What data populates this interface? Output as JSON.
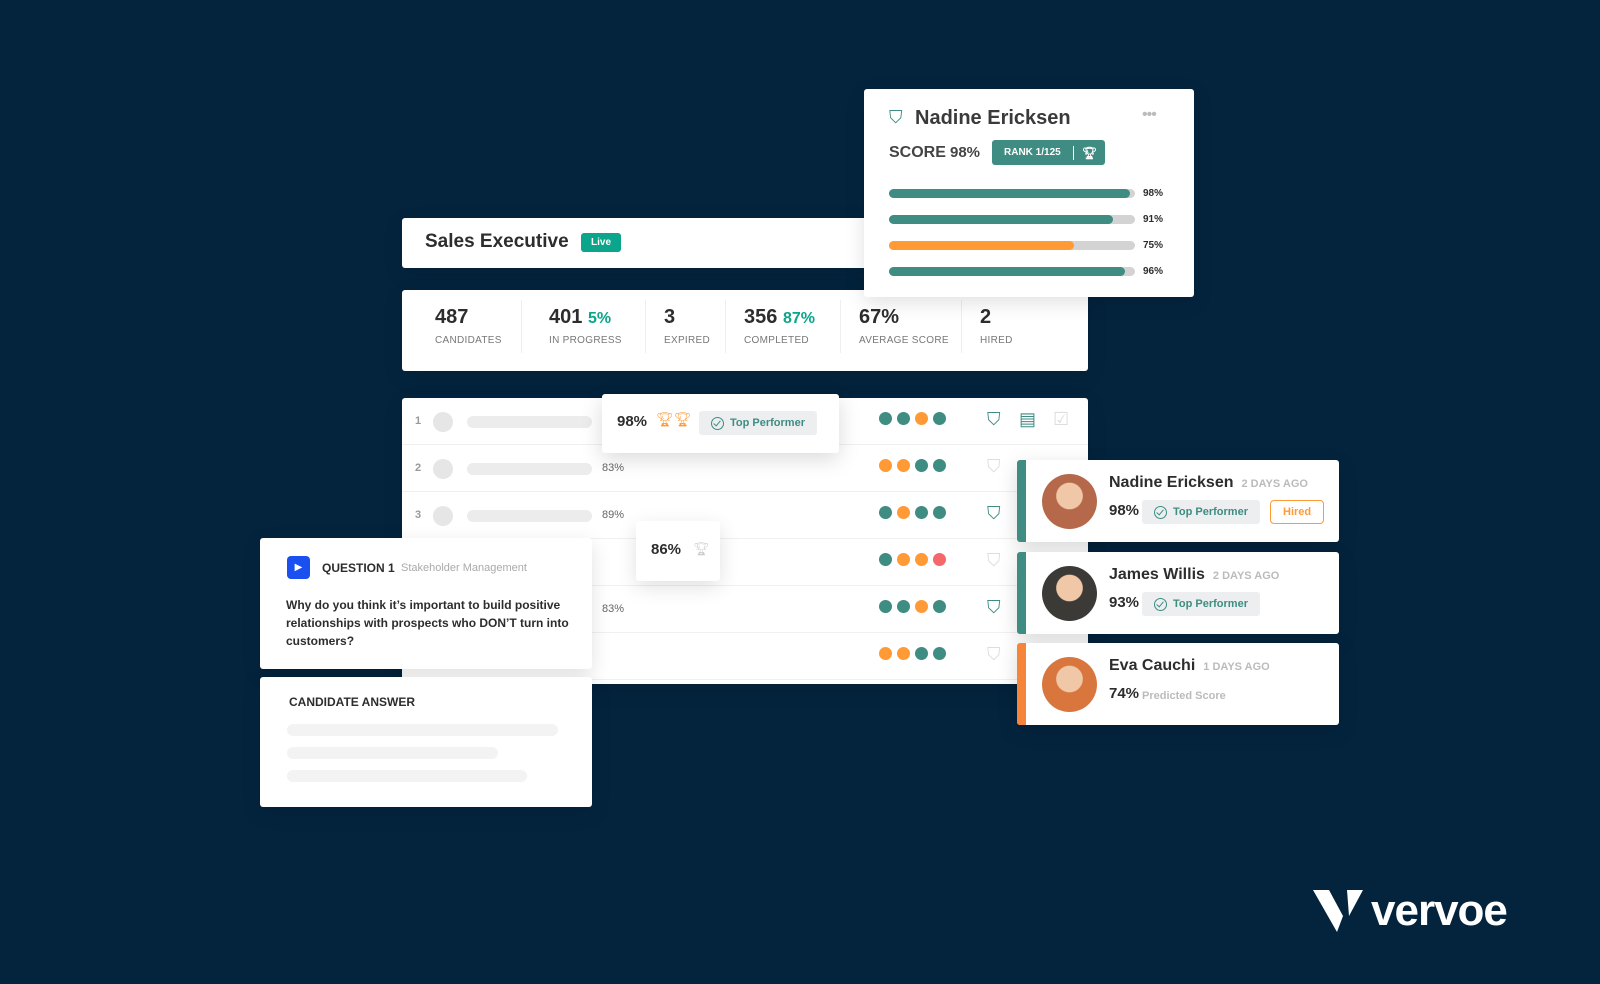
{
  "profile_card": {
    "name": "Nadine Ericksen",
    "score_label": "SCORE",
    "score": "98%",
    "rank": "RANK 1/125",
    "menu_icon": "ellipsis-icon",
    "bars": [
      {
        "label": "98%",
        "value": 98,
        "color": "#3e8c82"
      },
      {
        "label": "91%",
        "value": 91,
        "color": "#3e8c82"
      },
      {
        "label": "75%",
        "value": 75,
        "color": "#ff9a36"
      },
      {
        "label": "96%",
        "value": 96,
        "color": "#3e8c82"
      }
    ]
  },
  "header": {
    "title": "Sales Executive",
    "status": "Live"
  },
  "stats": [
    {
      "value": "487",
      "label": "CANDIDATES"
    },
    {
      "value": "401",
      "extra": "5%",
      "label": "IN PROGRESS"
    },
    {
      "value": "3",
      "label": "EXPIRED"
    },
    {
      "value": "356",
      "extra": "87%",
      "label": "COMPLETED"
    },
    {
      "value": "67%",
      "label": "AVERAGE SCORE"
    },
    {
      "value": "2",
      "label": "HIRED"
    }
  ],
  "table": {
    "rows": [
      {
        "rank": "1",
        "score": "",
        "dots": [
          "#3e8c82",
          "#3e8c82",
          "#ff9a36",
          "#3e8c82"
        ],
        "shortlisted": true
      },
      {
        "rank": "2",
        "score": "83%",
        "dots": [
          "#ff9a36",
          "#ff9a36",
          "#3e8c82",
          "#3e8c82"
        ],
        "shortlisted": false
      },
      {
        "rank": "3",
        "score": "89%",
        "dots": [
          "#3e8c82",
          "#ff9a36",
          "#3e8c82",
          "#3e8c82"
        ],
        "shortlisted": true
      },
      {
        "rank": "",
        "score": "",
        "dots": [
          "#3e8c82",
          "#ff9a36",
          "#ff9a36",
          "#f4676b"
        ],
        "shortlisted": false
      },
      {
        "rank": "",
        "score": "83%",
        "dots": [
          "#3e8c82",
          "#3e8c82",
          "#ff9a36",
          "#3e8c82"
        ],
        "shortlisted": true
      },
      {
        "rank": "",
        "score": "",
        "dots": [
          "#ff9a36",
          "#ff9a36",
          "#3e8c82",
          "#3e8c82"
        ],
        "shortlisted": false
      }
    ]
  },
  "top_popup": {
    "score": "98%",
    "badge": "Top Performer"
  },
  "mini_popup": {
    "score": "86%"
  },
  "question": {
    "label": "QUESTION 1",
    "category": "Stakeholder Management",
    "text": "Why do you think it’s important to build positive relationships with prospects who DON’T turn into customers?"
  },
  "answer": {
    "label": "CANDIDATE ANSWER"
  },
  "candidates": [
    {
      "name": "Nadine Ericksen",
      "ago": "2 DAYS AGO",
      "score": "98%",
      "badge": "Top Performer",
      "status": "Hired",
      "accent": "#3e8c82"
    },
    {
      "name": "James Willis",
      "ago": "2 DAYS AGO",
      "score": "93%",
      "badge": "Top Performer",
      "accent": "#3e8c82"
    },
    {
      "name": "Eva Cauchi",
      "ago": "1 DAYS AGO",
      "score": "74%",
      "note": "Predicted Score",
      "accent": "#f5853a"
    }
  ],
  "brand": {
    "name": "vervoe"
  }
}
